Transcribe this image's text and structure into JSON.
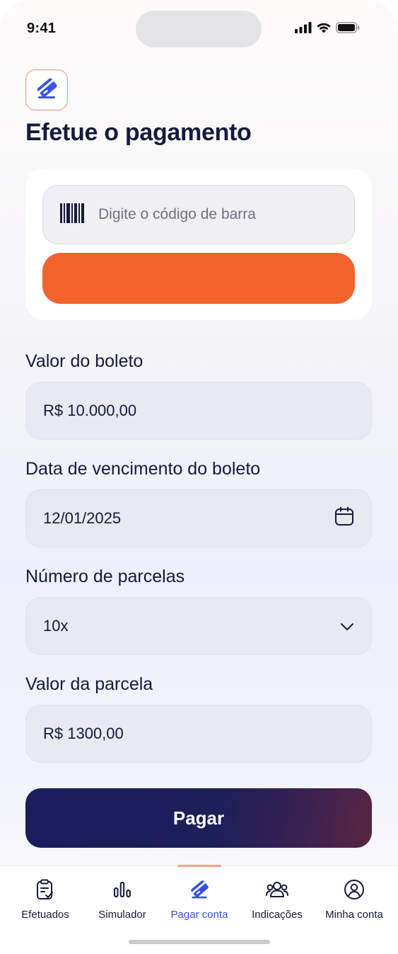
{
  "status_bar": {
    "time": "9:41",
    "icons": [
      "signal-icon",
      "wifi-icon",
      "battery-icon"
    ]
  },
  "app_icon": "card-pay-icon",
  "page": {
    "title": "Efetue o pagamento"
  },
  "barcode": {
    "placeholder": "Digite o código de barra",
    "icon": "barcode-icon",
    "button_label": ""
  },
  "form": {
    "amount": {
      "label": "Valor do boleto",
      "value": "R$ 10.000,00"
    },
    "due_date": {
      "label": "Data de vencimento do boleto",
      "value": "12/01/2025",
      "icon": "calendar-icon"
    },
    "installments": {
      "label": "Número de parcelas",
      "value": "10x",
      "icon": "chevron-down-icon"
    },
    "installment_value": {
      "label": "Valor da parcela",
      "value": "R$ 1300,00"
    }
  },
  "pay_button": {
    "label": "Pagar"
  },
  "tab_bar": {
    "active": "Pagar conta",
    "items": [
      {
        "label": "Efetuados",
        "icon": "clipboard-check-icon"
      },
      {
        "label": "Simulador",
        "icon": "bar-chart-icon"
      },
      {
        "label": "Pagar conta",
        "icon": "card-pay-icon"
      },
      {
        "label": "Indicações",
        "icon": "users-icon"
      },
      {
        "label": "Minha conta",
        "icon": "user-circle-icon"
      }
    ]
  },
  "colors": {
    "primary_orange": "#f2622a",
    "navy": "#161a3c",
    "active_blue": "#3750e0",
    "field_bg": "#e8e9f1"
  }
}
